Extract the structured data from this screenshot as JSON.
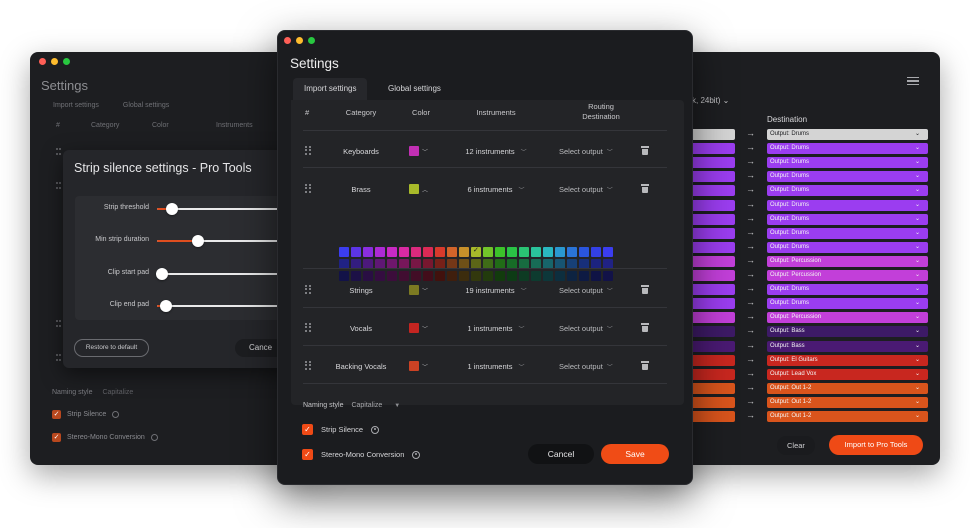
{
  "left_window": {
    "title": "Settings",
    "tabs": [
      "Import settings",
      "Global settings"
    ],
    "columns": [
      "#",
      "Category",
      "Color",
      "Instruments"
    ],
    "naming_label": "Naming style",
    "naming_value": "Capitalize",
    "checks": [
      "Strip Silence",
      "Stereo-Mono Conversion"
    ],
    "dialog": {
      "title": "Strip silence settings - Pro Tools",
      "sliders": [
        {
          "label": "Strip threshold",
          "value": 0.1
        },
        {
          "label": "Min strip duration",
          "value": 0.27
        },
        {
          "label": "Clip start pad",
          "value": 0.03
        },
        {
          "label": "Clip end pad",
          "value": 0.06
        }
      ],
      "restore_label": "Restore to default",
      "cancel_label": "Cance"
    }
  },
  "right_window": {
    "format_text": "k, 24bit) ⌄",
    "destination_header": "Destination",
    "rows": [
      {
        "src": "#d4d4d4",
        "dest": "Output: Drums",
        "color": "#d4d4d4",
        "dark_text": true
      },
      {
        "src": "#9b3df0",
        "dest": "Output: Drums",
        "color": "#9b3df0"
      },
      {
        "src": "#9b3df0",
        "dest": "Output: Drums",
        "color": "#9b3df0"
      },
      {
        "src": "#9b3df0",
        "dest": "Output: Drums",
        "color": "#9b3df0"
      },
      {
        "src": "#9b3df0",
        "dest": "Output: Drums",
        "color": "#9b3df0"
      },
      {
        "src": "#9b3df0",
        "dest": "Output: Drums",
        "color": "#9b3df0"
      },
      {
        "src": "#9b3df0",
        "dest": "Output: Drums",
        "color": "#9b3df0"
      },
      {
        "src": "#9b3df0",
        "dest": "Output: Drums",
        "color": "#9b3df0"
      },
      {
        "src": "#9b3df0",
        "dest": "Output: Drums",
        "color": "#9b3df0"
      },
      {
        "src": "#c23fd9",
        "dest": "Output: Percussion",
        "color": "#c23fd9"
      },
      {
        "src": "#c23fd9",
        "dest": "Output: Percussion",
        "color": "#c23fd9"
      },
      {
        "src": "#9b3df0",
        "dest": "Output: Drums",
        "color": "#9b3df0"
      },
      {
        "src": "#9b3df0",
        "dest": "Output: Drums",
        "color": "#9b3df0"
      },
      {
        "src": "#c23fd9",
        "dest": "Output: Percussion",
        "color": "#c23fd9"
      },
      {
        "src": "#3d1a66",
        "dest": "Output: Bass",
        "color": "#3d1a66"
      },
      {
        "src": "#4a1a73",
        "dest": "Output: Bass",
        "color": "#4a1a73"
      },
      {
        "src": "#c8271f",
        "dest": "Output: El Guitars",
        "color": "#c8271f"
      },
      {
        "src": "#c8271f",
        "dest": "Output: Lead Vox",
        "color": "#c8271f"
      },
      {
        "src": "#d9541c",
        "dest": "Output: Out 1-2",
        "color": "#d9541c"
      },
      {
        "src": "#d9541c",
        "dest": "Output: Out 1-2",
        "color": "#d9541c"
      },
      {
        "src": "#d9541c",
        "dest": "Output: Out 1-2",
        "color": "#d9541c"
      }
    ],
    "clear_label": "Clear",
    "import_label": "Import to Pro Tools"
  },
  "main_window": {
    "title": "Settings",
    "tabs": [
      "Import settings",
      "Global settings"
    ],
    "headers": {
      "num": "#",
      "category": "Category",
      "color": "Color",
      "instruments": "Instruments",
      "routing": "Routing Destination"
    },
    "rows": [
      {
        "category": "Keyboards",
        "color": "#c12fb4",
        "instruments": "12 instruments",
        "routing": "Select output",
        "open": false
      },
      {
        "category": "Brass",
        "color": "#a8ba2a",
        "instruments": "6 instruments",
        "routing": "Select output",
        "open": true
      },
      {
        "category": "Strings",
        "color": "#7c7a22",
        "instruments": "19 instruments",
        "routing": "Select output",
        "open": false
      },
      {
        "category": "Vocals",
        "color": "#c42521",
        "instruments": "1 instruments",
        "routing": "Select output",
        "open": false
      },
      {
        "category": "Backing Vocals",
        "color": "#cc4224",
        "instruments": "1 instruments",
        "routing": "Select output",
        "open": false
      }
    ],
    "palette": [
      "#3b3df0",
      "#5c35e8",
      "#8a2ee0",
      "#ad2ad5",
      "#c92ac4",
      "#d92aa3",
      "#db2a7e",
      "#db2a55",
      "#d83a2c",
      "#d2642a",
      "#c8912a",
      "#a8ba2a",
      "#72c42a",
      "#3cc42a",
      "#2ac446",
      "#2ac474",
      "#2ac49c",
      "#2ab8c0",
      "#2a98d0",
      "#2a74d8",
      "#2a55de",
      "#3340e6",
      "#3b3df0"
    ],
    "palette_selected": 11,
    "naming_label": "Naming style",
    "naming_value": "Capitalize",
    "checks": [
      "Strip Silence",
      "Stereo-Mono Conversion"
    ],
    "cancel_label": "Cancel",
    "save_label": "Save"
  }
}
